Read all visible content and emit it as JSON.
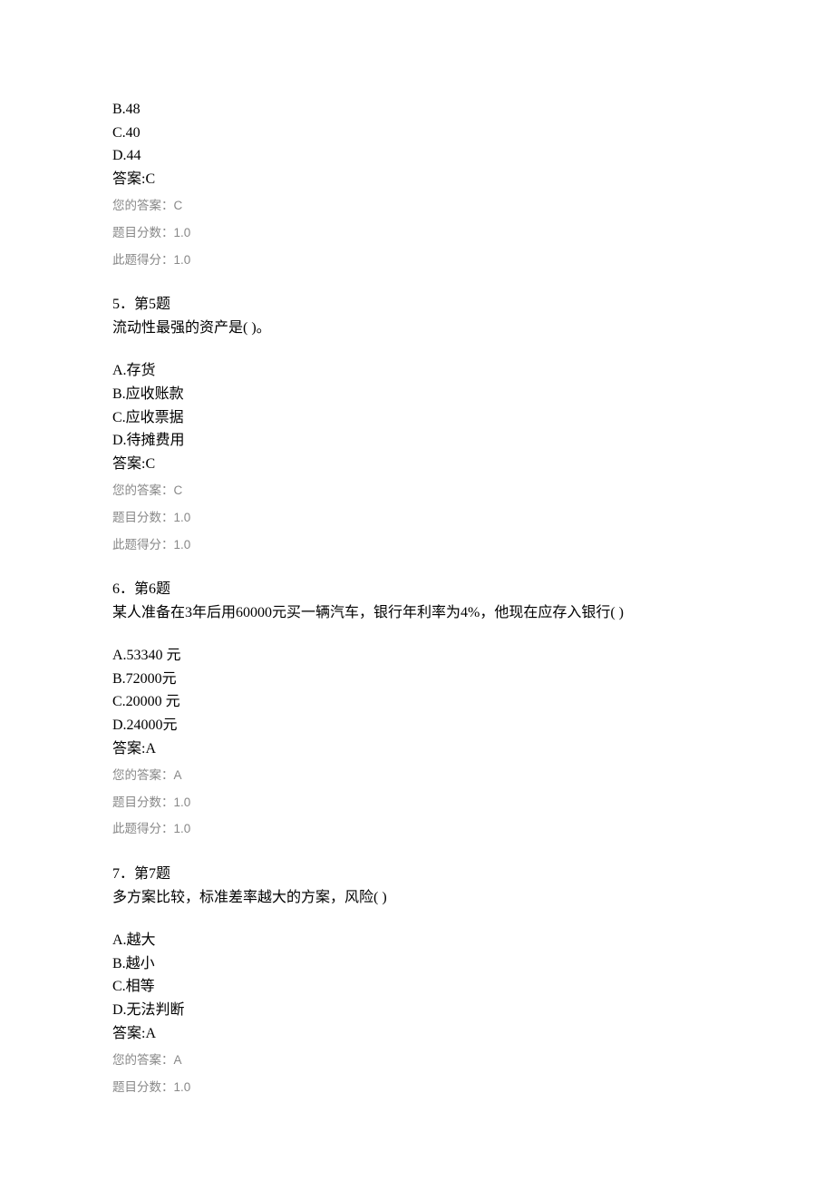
{
  "q4_tail": {
    "optB": "B.48",
    "optC": "C.40",
    "optD": "D.44",
    "answer": "答案:C",
    "your_answer": "您的答案：C",
    "score_line": "题目分数：1.0",
    "got_line": "此题得分：1.0"
  },
  "q5": {
    "header": "5．第5题",
    "stem": "流动性最强的资产是( )。",
    "optA": "A.存货",
    "optB": "B.应收账款",
    "optC": "C.应收票据",
    "optD": "D.待摊费用",
    "answer": "答案:C",
    "your_answer": "您的答案：C",
    "score_line": "题目分数：1.0",
    "got_line": "此题得分：1.0"
  },
  "q6": {
    "header": "6．第6题",
    "stem": "某人准备在3年后用60000元买一辆汽车，银行年利率为4%，他现在应存入银行( )",
    "optA": "A.53340  元",
    "optB": "B.72000元",
    "optC": "C.20000  元",
    "optD": "D.24000元",
    "answer": "答案:A",
    "your_answer": "您的答案：A",
    "score_line": "题目分数：1.0",
    "got_line": "此题得分：1.0"
  },
  "q7": {
    "header": "7．第7题",
    "stem": "多方案比较，标准差率越大的方案，风险(       )",
    "optA": "A.越大",
    "optB": "B.越小",
    "optC": "C.相等",
    "optD": "D.无法判断",
    "answer": "答案:A",
    "your_answer": "您的答案：A",
    "score_line": "题目分数：1.0"
  }
}
